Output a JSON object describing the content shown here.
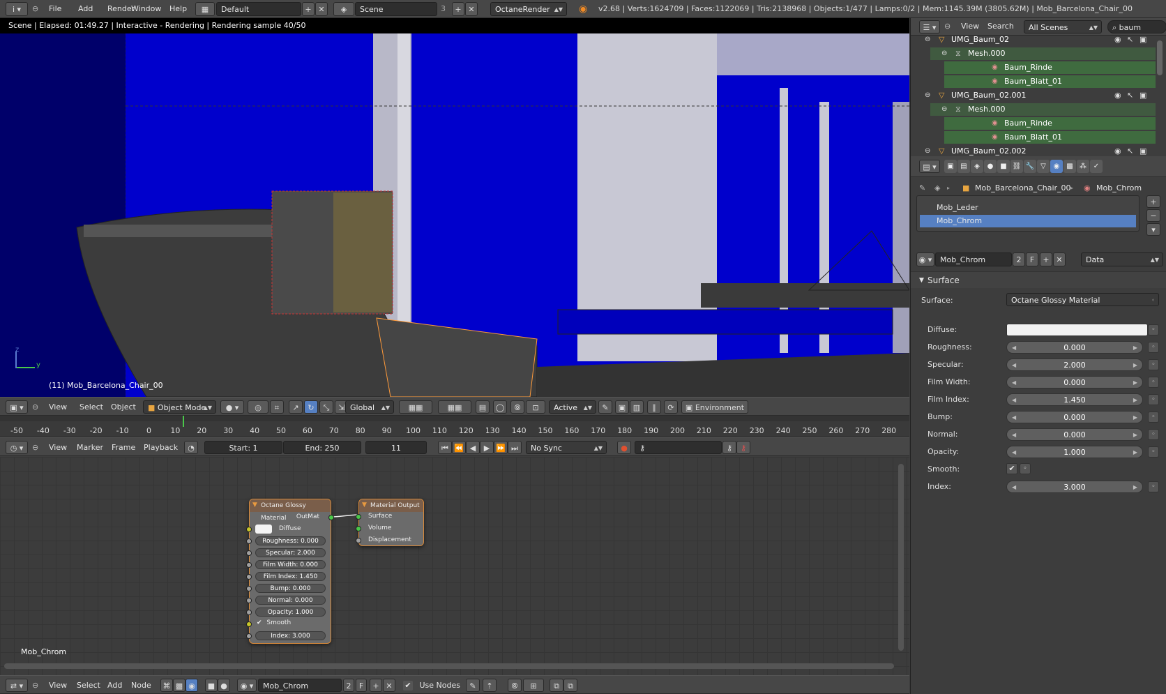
{
  "topbar": {
    "menus": [
      "File",
      "Add",
      "Render",
      "Window",
      "Help"
    ],
    "layout": "Default",
    "scene": "Scene",
    "scene_users": "3",
    "render_engine": "OctaneRender",
    "stats": "v2.68 | Verts:1624709 | Faces:1122069 | Tris:2138968 | Objects:1/477 | Lamps:0/2 | Mem:1145.39M (3805.62M) | Mob_Barcelona_Chair_00"
  },
  "viewport": {
    "status": "Scene | Elapsed: 01:49.27 | Interactive - Rendering | Rendering sample 40/50",
    "object_label": "(11) Mob_Barcelona_Chair_00",
    "axis_y": "y",
    "axis_z": "z"
  },
  "view3d_header": {
    "menus": [
      "View",
      "Select",
      "Object"
    ],
    "mode": "Object Mode",
    "orientation": "Global",
    "layer_mode": "Active",
    "environment": "Environment"
  },
  "timeline": {
    "ticks": [
      "-50",
      "-40",
      "-30",
      "-20",
      "-10",
      "0",
      "10",
      "20",
      "30",
      "40",
      "50",
      "60",
      "70",
      "80",
      "90",
      "100",
      "110",
      "120",
      "130",
      "140",
      "150",
      "160",
      "170",
      "180",
      "190",
      "200",
      "210",
      "220",
      "230",
      "240",
      "250",
      "260",
      "270",
      "280"
    ],
    "current_frame_marker": 11,
    "menus": [
      "View",
      "Marker",
      "Frame",
      "Playback"
    ],
    "start": "Start: 1",
    "end": "End: 250",
    "current": "11",
    "sync": "No Sync"
  },
  "node_editor": {
    "material_label": "Mob_Chrom",
    "glossy_node": {
      "title": "Octane Glossy Material",
      "output": "OutMat",
      "diffuse": "Diffuse",
      "rows": [
        "Roughness: 0.000",
        "Specular: 2.000",
        "Film Width: 0.000",
        "Film Index: 1.450",
        "Bump: 0.000",
        "Normal: 0.000",
        "Opacity: 1.000"
      ],
      "smooth": "Smooth",
      "index": "Index: 3.000"
    },
    "output_node": {
      "title": "Material Output",
      "inputs": [
        "Surface",
        "Volume",
        "Displacement"
      ]
    },
    "footer": {
      "menus": [
        "View",
        "Select",
        "Add",
        "Node"
      ],
      "material": "Mob_Chrom",
      "users": "2",
      "fake": "F",
      "use_nodes": "Use Nodes"
    }
  },
  "outliner": {
    "menus": [
      "View",
      "Search"
    ],
    "scene_filter": "All Scenes",
    "search": "baum",
    "rows": [
      {
        "label": "UMG_Baum_02",
        "indent": 1,
        "kind": "object"
      },
      {
        "label": "Mesh.000",
        "indent": 2,
        "kind": "mesh"
      },
      {
        "label": "Baum_Rinde",
        "indent": 3,
        "kind": "material"
      },
      {
        "label": "Baum_Blatt_01",
        "indent": 3,
        "kind": "material"
      },
      {
        "label": "UMG_Baum_02.001",
        "indent": 1,
        "kind": "object"
      },
      {
        "label": "Mesh.000",
        "indent": 2,
        "kind": "mesh"
      },
      {
        "label": "Baum_Rinde",
        "indent": 3,
        "kind": "material"
      },
      {
        "label": "Baum_Blatt_01",
        "indent": 3,
        "kind": "material"
      },
      {
        "label": "UMG_Baum_02.002",
        "indent": 1,
        "kind": "object"
      }
    ]
  },
  "properties": {
    "breadcrumb_object": "Mob_Barcelona_Chair_00",
    "breadcrumb_material": "Mob_Chrom",
    "slots": [
      "Mob_Leder",
      "Mob_Chrom"
    ],
    "selected_slot": 1,
    "material_name": "Mob_Chrom",
    "users": "2",
    "fake": "F",
    "link": "Data",
    "panel_title": "Surface",
    "surface_label": "Surface:",
    "surface_value": "Octane Glossy Material",
    "fields": [
      {
        "label": "Diffuse:",
        "value": "",
        "kind": "color"
      },
      {
        "label": "Roughness:",
        "value": "0.000"
      },
      {
        "label": "Specular:",
        "value": "2.000"
      },
      {
        "label": "Film Width:",
        "value": "0.000"
      },
      {
        "label": "Film Index:",
        "value": "1.450"
      },
      {
        "label": "Bump:",
        "value": "0.000"
      },
      {
        "label": "Normal:",
        "value": "0.000"
      },
      {
        "label": "Opacity:",
        "value": "1.000"
      },
      {
        "label": "Smooth:",
        "value": "",
        "kind": "check"
      },
      {
        "label": "Index:",
        "value": "3.000"
      }
    ]
  },
  "colors": {
    "accent_blue": "#5680c2",
    "selection_orange": "#ff9a3a",
    "outliner_material_bg": "#3f6b3f"
  }
}
